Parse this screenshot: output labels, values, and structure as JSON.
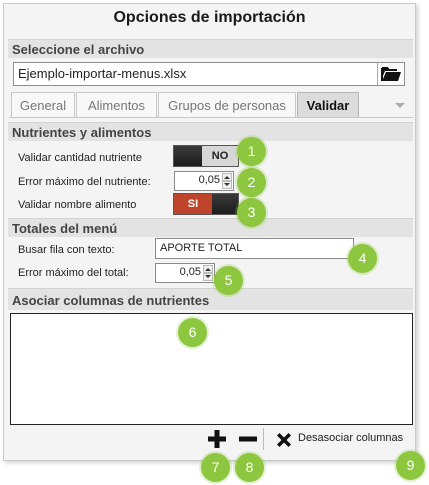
{
  "title": "Opciones de importación",
  "file_section": {
    "heading": "Seleccione el archivo",
    "filename": "Ejemplo-importar-menus.xlsx",
    "browse_icon": "folder-open-icon"
  },
  "tabs": [
    {
      "label": "General",
      "active": false
    },
    {
      "label": "Alimentos",
      "active": false
    },
    {
      "label": "Grupos de personas",
      "active": false
    },
    {
      "label": "Validar",
      "active": true
    }
  ],
  "nutrients_section": {
    "heading": "Nutrientes y alimentos",
    "validate_amount_label": "Validar cantidad nutriente",
    "validate_amount_toggle": "NO",
    "max_error_label": "Error máximo del nutriente:",
    "max_error_value": "0,05",
    "validate_name_label": "Validar nombre alimento",
    "validate_name_toggle": "SI"
  },
  "totals_section": {
    "heading": "Totales del menú",
    "search_row_label": "Busar fila con texto:",
    "search_row_value": "APORTE TOTAL",
    "max_total_error_label": "Error máximo del total:",
    "max_total_error_value": "0,05"
  },
  "columns_section": {
    "heading": "Asociar columnas de nutrientes"
  },
  "footer": {
    "add_icon": "plus-icon",
    "remove_icon": "minus-icon",
    "disassociate_icon": "x-icon",
    "disassociate_label": "Desasociar columnas"
  },
  "badges": [
    "1",
    "2",
    "3",
    "4",
    "5",
    "6",
    "7",
    "8",
    "9"
  ],
  "colors": {
    "badge": "#8dc63f",
    "toggle_on": "#c0442b",
    "toggle_off": "#2f2f2f"
  }
}
